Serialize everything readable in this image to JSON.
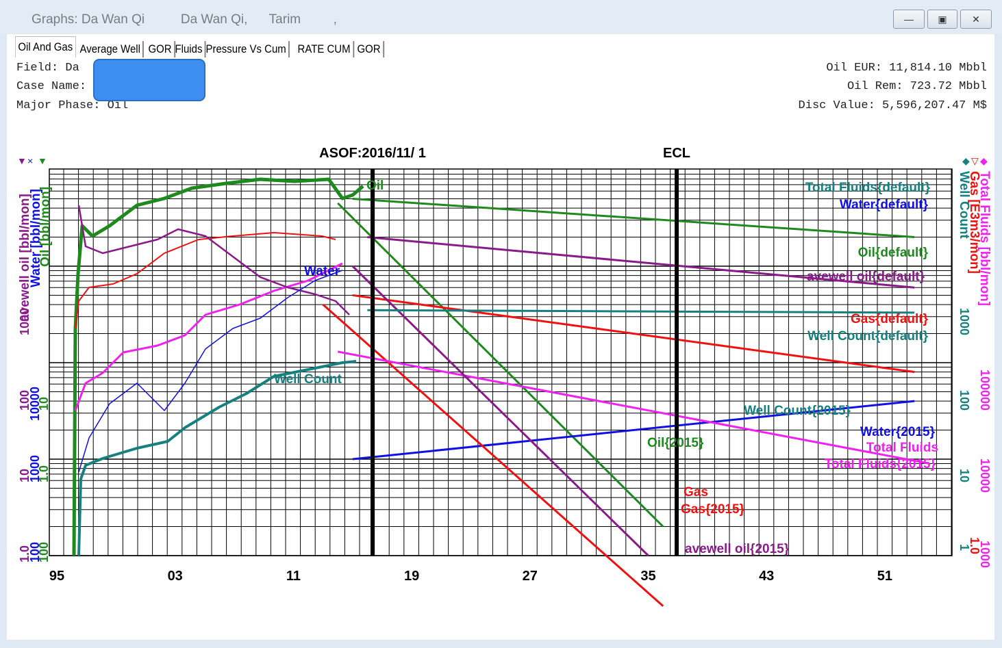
{
  "window": {
    "title": "Graphs: Da Wan Qi          Da Wan Qi,      Tarim         ,",
    "minimize_glyph": "—",
    "maximize_glyph": "▣",
    "close_glyph": "✕"
  },
  "tabs": [
    {
      "label": "Oil And Gas",
      "active": true
    },
    {
      "label": "Average Well"
    },
    {
      "label": "GOR"
    },
    {
      "label": "Fluids"
    },
    {
      "label": "Pressure Vs Cum"
    },
    {
      "label": "RATE CUM"
    },
    {
      "label": "GOR"
    }
  ],
  "info": {
    "field": "Field: Da",
    "case_name": "Case Name:",
    "major_phase": "Major Phase: Oil",
    "oil_eur": "Oil EUR: 11,814.10 Mbbl",
    "oil_rem": "Oil Rem: 723.72 Mbbl",
    "disc_value": "Disc Value: 5,596,207.47 M$"
  },
  "colors": {
    "oil": "#1e8a1e",
    "water": "#1010e0",
    "gas": "#f01010",
    "avewell": "#8a1a8a",
    "wellcount": "#168080",
    "totalfluids": "#f020f0",
    "redaction": "#3d8ef0"
  },
  "chart_data": {
    "type": "line",
    "log_scale": true,
    "grid": true,
    "x_ticks": [
      "95",
      "03",
      "11",
      "19",
      "27",
      "35",
      "43",
      "51"
    ],
    "markers": [
      {
        "label": "ASOF:2016/11/ 1",
        "x": "2016-11"
      },
      {
        "label": "ECL",
        "x": "2036"
      }
    ],
    "left_axis_labels": [
      {
        "text": "avewell oil [bbl/mon]",
        "series": "avewell"
      },
      {
        "text": "Water [bbl/mon]",
        "series": "water"
      },
      {
        "text": "Oil [bbl/mon]",
        "series": "oil"
      }
    ],
    "right_axis_labels": [
      {
        "text": "Well Count",
        "series": "wellcount"
      },
      {
        "text": "Gas [E3m3/mon]",
        "series": "gas"
      },
      {
        "text": "Total Fluids [bbl/mon]",
        "series": "totalfluids"
      }
    ],
    "left_tick_labels": [
      {
        "text": "1.0",
        "series": "avewell"
      },
      {
        "text": "100",
        "series": "water"
      },
      {
        "text": "100",
        "series": "oil"
      },
      {
        "text": "10",
        "series": "avewell"
      },
      {
        "text": "1000",
        "series": "water"
      },
      {
        "text": "1.0",
        "series": "oil"
      },
      {
        "text": "100",
        "series": "avewell"
      },
      {
        "text": "10000",
        "series": "water"
      },
      {
        "text": "10",
        "series": "oil"
      },
      {
        "text": "1000",
        "series": "avewell"
      }
    ],
    "right_tick_labels": [
      {
        "text": "1",
        "series": "wellcount"
      },
      {
        "text": "1.0",
        "series": "gas"
      },
      {
        "text": "1000",
        "series": "totalfluids"
      },
      {
        "text": "10",
        "series": "wellcount"
      },
      {
        "text": "10000",
        "series": "totalfluids"
      },
      {
        "text": "100",
        "series": "wellcount"
      },
      {
        "text": "100000",
        "series": "totalfluids"
      },
      {
        "text": "1000",
        "series": "wellcount"
      }
    ],
    "legend_icons": {
      "left": [
        "▼",
        "×",
        "▼"
      ],
      "right": [
        "◆",
        "▽",
        "◆"
      ]
    },
    "series_labels": [
      {
        "text": "Oil",
        "series": "oil"
      },
      {
        "text": "Water",
        "series": "water"
      },
      {
        "text": "Well Count",
        "series": "wellcount"
      },
      {
        "text": "Total Fluids{default}",
        "series": "wellcount"
      },
      {
        "text": "Water{default}",
        "series": "water"
      },
      {
        "text": "Oil{default}",
        "series": "oil"
      },
      {
        "text": "avewell oil{default}",
        "series": "avewell"
      },
      {
        "text": "Gas{default}",
        "series": "gas"
      },
      {
        "text": "Well Count{default}",
        "series": "wellcount"
      },
      {
        "text": "Well Count{2015}",
        "series": "wellcount"
      },
      {
        "text": "Water{2015}",
        "series": "water"
      },
      {
        "text": "Total Fluids",
        "series": "totalfluids"
      },
      {
        "text": "Total Fluids{2015}",
        "series": "totalfluids"
      },
      {
        "text": "Oil{2015}",
        "series": "oil"
      },
      {
        "text": "Gas",
        "series": "gas"
      },
      {
        "text": "Gas{2015}",
        "series": "gas"
      },
      {
        "text": "avewell oil{2015}",
        "series": "avewell"
      }
    ],
    "forecast_lines": [
      {
        "name": "Oil{default}",
        "series": "oil",
        "points": [
          [
            "2015",
            50000
          ],
          [
            "2053",
            20000
          ]
        ]
      },
      {
        "name": "Oil{2015}",
        "series": "oil",
        "points": [
          [
            "2014",
            45000
          ],
          [
            "2036",
            20
          ]
        ]
      },
      {
        "name": "Water{default}",
        "series": "water",
        "points": [
          [
            "2015",
            1000
          ],
          [
            "2053",
            4000
          ]
        ]
      },
      {
        "name": "Gas{default}",
        "series": "gas",
        "points": [
          [
            "2015",
            500
          ],
          [
            "2053",
            80
          ]
        ]
      },
      {
        "name": "Gas{2015}",
        "series": "gas",
        "points": [
          [
            "2013",
            400
          ],
          [
            "2036",
            0.3
          ]
        ]
      },
      {
        "name": "Total Fluids{2015}",
        "series": "totalfluids",
        "points": [
          [
            "2014",
            130000
          ],
          [
            "2054",
            9000
          ]
        ]
      },
      {
        "name": "avewell oil{default}",
        "series": "avewell",
        "points": [
          [
            "2016",
            2000
          ],
          [
            "2053",
            600
          ]
        ]
      },
      {
        "name": "avewell oil{2015}",
        "series": "avewell",
        "points": [
          [
            "2015",
            1000
          ],
          [
            "2035",
            1
          ]
        ]
      },
      {
        "name": "Well Count{default}",
        "series": "wellcount",
        "points": [
          [
            "2016",
            350
          ],
          [
            "2053",
            330
          ]
        ]
      }
    ]
  }
}
